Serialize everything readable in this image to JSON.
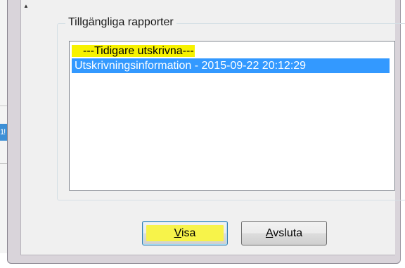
{
  "dialog": {
    "group_title": "Tillgängliga rapporter",
    "list_items": [
      {
        "label": "---Tidigare utskrivna---",
        "selected": false,
        "highlighted": true
      },
      {
        "label": "Utskrivningsinformation - 2015-09-22 20:12:29",
        "selected": true,
        "highlighted": false
      }
    ],
    "buttons": {
      "visa": {
        "label": "Visa",
        "underline": "V",
        "rest": "isa"
      },
      "avsluta": {
        "label": "Avsluta",
        "underline": "A",
        "rest": "vsluta"
      }
    }
  },
  "background_app": {
    "selected_cell_text": "1!"
  },
  "colors": {
    "selection": "#3399ff",
    "highlight": "#f7f200",
    "dialog_bg": "#f0f0f0",
    "frame": "#d9d4da"
  }
}
